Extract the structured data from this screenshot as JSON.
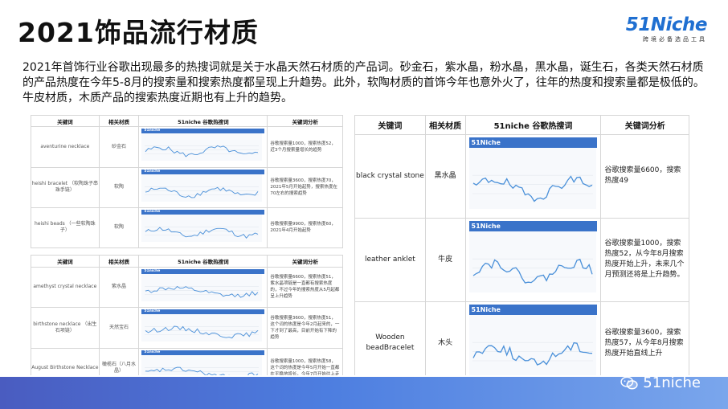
{
  "page": {
    "title": "2021饰品流行材质",
    "logo_main": "51Niche",
    "logo_sub": "跨境必备选品工具",
    "intro": "2021年首饰行业谷歌出现最多的热搜词就是关于水晶天然石材质的产品词。砂金石，紫水晶，粉水晶，黑水晶，诞生石，各类天然石材质的产品热度在今年5-8月的搜索量和搜索热度都呈现上升趋势。此外，软陶材质的首饰今年也意外火了，往年的热度和搜索量都是极低的。牛皮材质，木质产品的搜索热度近期也有上升的趋势。",
    "watermark": "51niche"
  },
  "headers_upper": [
    "关键词",
    "相关材质",
    "51niche 谷歌热搜词",
    "关键词分析"
  ],
  "headers_lower": [
    "关键词",
    "相关材质",
    "51niche 谷歌热搜词",
    "关键词分析"
  ],
  "headers_right": [
    "关键词",
    "相关材质",
    "51niche 谷歌热搜词",
    "关键词分析"
  ],
  "mini_chart_header_small": "51niche",
  "mini_chart_header_big": "51Niche",
  "rows_upper": [
    {
      "keyword": "aventurine necklace",
      "material": "砂金石",
      "note": "谷歌搜索量1000，搜索热度52，近3个月搜索量增长的趋势"
    },
    {
      "keyword": "heishi bracelet （软陶珠子串珠手链）",
      "material": "软陶",
      "note": "谷歌搜索量3600，搜索热度70，2021年5月开始起势，搜索热度在70左右的搜索趋势"
    },
    {
      "keyword": "heishi beads （一些软陶珠子）",
      "material": "软陶",
      "note": "谷歌搜索量9900，搜索热度60，2021年4月开始起势"
    }
  ],
  "rows_lower": [
    {
      "keyword": "amethyst crystal necklace",
      "material": "紫水晶",
      "note": "谷歌搜索量6600，搜索热度51，紫水晶项链是一直都有搜索热度的，不过今年的搜索热度从5月起都呈上升趋势"
    },
    {
      "keyword": "birthstone necklace （出生石项链）",
      "material": "天然宝石",
      "note": "谷歌搜索量3600，搜索热度51，这个词的热度是今年2月起来的，一下才到了最高，目前开始有下降的趋势"
    },
    {
      "keyword": "August Birthstone Necklace",
      "material": "橄榄石（八月水晶）",
      "note": "谷歌搜索量1000，搜索热度58，这个词的热度是今年5月开始一直都在平稳地增长，今年7月开始往上走"
    }
  ],
  "rows_right": [
    {
      "keyword": "black crystal stone",
      "material": "黑水晶",
      "note": "谷歌搜索量6600，搜索热度49"
    },
    {
      "keyword": "leather anklet",
      "material": "牛皮",
      "note": "谷歌搜索量1000，搜索热度52，从今年8月搜索热度开始上升，未来几个月预测还将是上升趋势。"
    },
    {
      "keyword": "Wooden beadBracelet",
      "material": "木头",
      "note": "谷歌搜索量3600，搜索热度57，从今年8月搜索热度开始直线上升"
    }
  ],
  "colors": {
    "chart_header": "#3a73c9",
    "trend_line": "#4a90d9",
    "footer_start": "#4a5cc0",
    "footer_end": "#7aa6ec",
    "logo": "#1f6fd1"
  },
  "icons": [
    "wechat-icon"
  ]
}
